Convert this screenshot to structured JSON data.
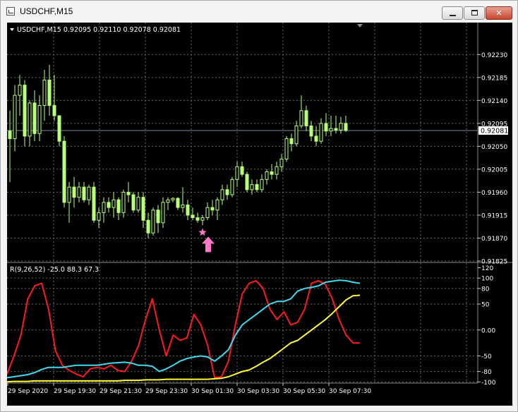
{
  "window": {
    "title": "USDCHF,M15",
    "icon": "chart-window-icon",
    "controls": [
      "minimize-icon",
      "maximize-icon",
      "close-icon"
    ]
  },
  "chart": {
    "header": "USDCHF,M15  0.92095 0.92110 0.92078 0.92081",
    "symbol": "USDCHF",
    "timeframe": "M15",
    "current_price_label": "0.92081",
    "colors": {
      "background": "#000000",
      "grid": "#6a6a6a",
      "candle": "#b7ff7a",
      "bid_line": "#7e8a9c",
      "signal_star": "#ff79c6",
      "signal_arrow": "#ff79c6",
      "indicator_red": "#ff1a1a",
      "indicator_cyan": "#3fd9f0",
      "indicator_yellow": "#ffff33"
    }
  },
  "indicator": {
    "header": "R(9,26,52) -25.0 88.3 67.3"
  },
  "chart_data": {
    "type": "candlestick",
    "price_axis": [
      "0.92230",
      "0.92185",
      "0.92140",
      "0.92095",
      "0.92050",
      "0.92005",
      "0.91960",
      "0.91915",
      "0.91870",
      "0.91825"
    ],
    "price_range": [
      0.91825,
      0.92265
    ],
    "current_price": 0.92081,
    "indicator_axis": [
      "120",
      "100",
      "80",
      "50",
      "0.00",
      "-50",
      "-80",
      "-100"
    ],
    "indicator_range": [
      -105,
      122
    ],
    "time_axis": [
      "29 Sep 2020",
      "29 Sep 19:30",
      "29 Sep 21:30",
      "29 Sep 23:30",
      "30 Sep 01:30",
      "30 Sep 03:30",
      "30 Sep 05:30",
      "30 Sep 07:30"
    ],
    "candles": [
      {
        "o": 0.9208,
        "h": 0.9212,
        "l": 0.9198,
        "c": 0.92065
      },
      {
        "o": 0.92065,
        "h": 0.9217,
        "l": 0.9204,
        "c": 0.9215
      },
      {
        "o": 0.9215,
        "h": 0.9219,
        "l": 0.9211,
        "c": 0.9217
      },
      {
        "o": 0.9217,
        "h": 0.9218,
        "l": 0.9205,
        "c": 0.9207
      },
      {
        "o": 0.9207,
        "h": 0.9214,
        "l": 0.9205,
        "c": 0.92135
      },
      {
        "o": 0.92135,
        "h": 0.9216,
        "l": 0.9206,
        "c": 0.92075
      },
      {
        "o": 0.92075,
        "h": 0.9215,
        "l": 0.9206,
        "c": 0.9213
      },
      {
        "o": 0.9213,
        "h": 0.922,
        "l": 0.921,
        "c": 0.9218
      },
      {
        "o": 0.9218,
        "h": 0.9221,
        "l": 0.9211,
        "c": 0.9213
      },
      {
        "o": 0.9213,
        "h": 0.9219,
        "l": 0.921,
        "c": 0.9211
      },
      {
        "o": 0.9211,
        "h": 0.9211,
        "l": 0.9205,
        "c": 0.9206
      },
      {
        "o": 0.9206,
        "h": 0.9207,
        "l": 0.9193,
        "c": 0.9194
      },
      {
        "o": 0.9194,
        "h": 0.9198,
        "l": 0.919,
        "c": 0.9197
      },
      {
        "o": 0.9197,
        "h": 0.9199,
        "l": 0.9193,
        "c": 0.9195
      },
      {
        "o": 0.9195,
        "h": 0.9198,
        "l": 0.9194,
        "c": 0.9197
      },
      {
        "o": 0.9197,
        "h": 0.9198,
        "l": 0.9194,
        "c": 0.91945
      },
      {
        "o": 0.91945,
        "h": 0.91975,
        "l": 0.91935,
        "c": 0.9197
      },
      {
        "o": 0.9197,
        "h": 0.9198,
        "l": 0.919,
        "c": 0.91905
      },
      {
        "o": 0.91905,
        "h": 0.9193,
        "l": 0.9189,
        "c": 0.9192
      },
      {
        "o": 0.9192,
        "h": 0.9195,
        "l": 0.919,
        "c": 0.9194
      },
      {
        "o": 0.9194,
        "h": 0.9195,
        "l": 0.9192,
        "c": 0.9193
      },
      {
        "o": 0.9193,
        "h": 0.9196,
        "l": 0.9191,
        "c": 0.91945
      },
      {
        "o": 0.91945,
        "h": 0.9195,
        "l": 0.91905,
        "c": 0.9192
      },
      {
        "o": 0.9192,
        "h": 0.91965,
        "l": 0.9191,
        "c": 0.9196
      },
      {
        "o": 0.9196,
        "h": 0.9198,
        "l": 0.9194,
        "c": 0.91955
      },
      {
        "o": 0.91955,
        "h": 0.9196,
        "l": 0.9192,
        "c": 0.91925
      },
      {
        "o": 0.91925,
        "h": 0.9196,
        "l": 0.9192,
        "c": 0.9195
      },
      {
        "o": 0.9195,
        "h": 0.9196,
        "l": 0.9189,
        "c": 0.91905
      },
      {
        "o": 0.91905,
        "h": 0.9192,
        "l": 0.9187,
        "c": 0.9188
      },
      {
        "o": 0.9188,
        "h": 0.9193,
        "l": 0.91875,
        "c": 0.91925
      },
      {
        "o": 0.91925,
        "h": 0.91935,
        "l": 0.9188,
        "c": 0.919
      },
      {
        "o": 0.919,
        "h": 0.9195,
        "l": 0.9189,
        "c": 0.9194
      },
      {
        "o": 0.9194,
        "h": 0.9195,
        "l": 0.91925,
        "c": 0.91945
      },
      {
        "o": 0.91945,
        "h": 0.9195,
        "l": 0.9194,
        "c": 0.91948
      },
      {
        "o": 0.91948,
        "h": 0.9195,
        "l": 0.91925,
        "c": 0.9193
      },
      {
        "o": 0.9193,
        "h": 0.9197,
        "l": 0.9192,
        "c": 0.91935
      },
      {
        "o": 0.91935,
        "h": 0.91945,
        "l": 0.91905,
        "c": 0.91915
      },
      {
        "o": 0.91915,
        "h": 0.9193,
        "l": 0.91905,
        "c": 0.9191
      },
      {
        "o": 0.9191,
        "h": 0.9192,
        "l": 0.919,
        "c": 0.91905
      },
      {
        "o": 0.91905,
        "h": 0.91915,
        "l": 0.91895,
        "c": 0.9191
      },
      {
        "o": 0.9191,
        "h": 0.9194,
        "l": 0.91905,
        "c": 0.9193
      },
      {
        "o": 0.9193,
        "h": 0.91945,
        "l": 0.91915,
        "c": 0.91925
      },
      {
        "o": 0.91925,
        "h": 0.9195,
        "l": 0.91905,
        "c": 0.91945
      },
      {
        "o": 0.91945,
        "h": 0.91975,
        "l": 0.91935,
        "c": 0.91965
      },
      {
        "o": 0.91965,
        "h": 0.91975,
        "l": 0.91945,
        "c": 0.91955
      },
      {
        "o": 0.91955,
        "h": 0.9199,
        "l": 0.9195,
        "c": 0.91985
      },
      {
        "o": 0.91985,
        "h": 0.9202,
        "l": 0.9197,
        "c": 0.9201
      },
      {
        "o": 0.9201,
        "h": 0.9202,
        "l": 0.9199,
        "c": 0.91995
      },
      {
        "o": 0.91995,
        "h": 0.92,
        "l": 0.9196,
        "c": 0.91965
      },
      {
        "o": 0.91965,
        "h": 0.91985,
        "l": 0.91955,
        "c": 0.91975
      },
      {
        "o": 0.91975,
        "h": 0.91985,
        "l": 0.9196,
        "c": 0.91965
      },
      {
        "o": 0.91965,
        "h": 0.91995,
        "l": 0.9196,
        "c": 0.91985
      },
      {
        "o": 0.91985,
        "h": 0.92005,
        "l": 0.91975,
        "c": 0.92
      },
      {
        "o": 0.92,
        "h": 0.92015,
        "l": 0.91985,
        "c": 0.91995
      },
      {
        "o": 0.91995,
        "h": 0.9202,
        "l": 0.91985,
        "c": 0.9201
      },
      {
        "o": 0.9201,
        "h": 0.92035,
        "l": 0.92,
        "c": 0.92025
      },
      {
        "o": 0.92025,
        "h": 0.9207,
        "l": 0.9202,
        "c": 0.92065
      },
      {
        "o": 0.92065,
        "h": 0.92075,
        "l": 0.9204,
        "c": 0.92055
      },
      {
        "o": 0.92055,
        "h": 0.921,
        "l": 0.9205,
        "c": 0.9209
      },
      {
        "o": 0.9209,
        "h": 0.9215,
        "l": 0.92085,
        "c": 0.9212
      },
      {
        "o": 0.9212,
        "h": 0.9213,
        "l": 0.9208,
        "c": 0.9209
      },
      {
        "o": 0.9209,
        "h": 0.921,
        "l": 0.9206,
        "c": 0.9207
      },
      {
        "o": 0.9207,
        "h": 0.9209,
        "l": 0.9205,
        "c": 0.9206
      },
      {
        "o": 0.9206,
        "h": 0.92105,
        "l": 0.92055,
        "c": 0.92095
      },
      {
        "o": 0.92095,
        "h": 0.92115,
        "l": 0.9207,
        "c": 0.9208
      },
      {
        "o": 0.9208,
        "h": 0.9211,
        "l": 0.9207,
        "c": 0.92085
      },
      {
        "o": 0.92085,
        "h": 0.9211,
        "l": 0.92075,
        "c": 0.92082
      },
      {
        "o": 0.92082,
        "h": 0.92108,
        "l": 0.92075,
        "c": 0.92095
      },
      {
        "o": 0.92095,
        "h": 0.9211,
        "l": 0.92078,
        "c": 0.92081
      }
    ],
    "signal_index": 39,
    "series": [
      {
        "color": "red",
        "values": [
          -85,
          -50,
          -10,
          60,
          85,
          90,
          40,
          -40,
          -68,
          -78,
          -85,
          -90,
          -75,
          -72,
          -75,
          -68,
          -78,
          -80,
          -60,
          -30,
          20,
          60,
          0,
          -50,
          -10,
          -20,
          -15,
          30,
          10,
          -30,
          -92,
          -90,
          -60,
          10,
          70,
          90,
          95,
          80,
          40,
          20,
          35,
          10,
          15,
          40,
          90,
          95,
          88,
          60,
          20,
          -10,
          -25,
          -25
        ]
      },
      {
        "color": "cyan",
        "values": [
          -92,
          -90,
          -88,
          -86,
          -82,
          -76,
          -72,
          -72,
          -72,
          -70,
          -68,
          -68,
          -68,
          -68,
          -66,
          -64,
          -63,
          -62,
          -64,
          -68,
          -68,
          -70,
          -80,
          -75,
          -68,
          -60,
          -55,
          -52,
          -50,
          -52,
          -60,
          -50,
          -38,
          -10,
          10,
          20,
          30,
          40,
          50,
          55,
          55,
          60,
          75,
          80,
          82,
          85,
          92,
          94,
          96,
          95,
          92,
          90
        ]
      },
      {
        "color": "yellow",
        "values": [
          -100,
          -99,
          -99,
          -99,
          -98,
          -98,
          -98,
          -98,
          -98,
          -98,
          -98,
          -98,
          -98,
          -98,
          -98,
          -98,
          -98,
          -97,
          -97,
          -97,
          -96,
          -96,
          -96,
          -95,
          -95,
          -95,
          -95,
          -95,
          -95,
          -95,
          -94,
          -93,
          -90,
          -85,
          -80,
          -77,
          -70,
          -62,
          -55,
          -45,
          -35,
          -25,
          -20,
          -10,
          0,
          10,
          20,
          32,
          45,
          58,
          66,
          67
        ]
      }
    ]
  }
}
